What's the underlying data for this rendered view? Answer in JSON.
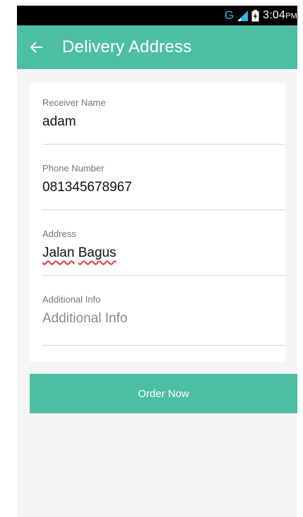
{
  "status_bar": {
    "network_type": "G",
    "time": "3:04",
    "ampm": "PM",
    "icons": [
      "signal-icon",
      "battery-icon"
    ],
    "network_color": "#33b5e5"
  },
  "app_bar": {
    "title": "Delivery Address",
    "back_icon": "arrow-left-icon",
    "background": "#4cbfa2"
  },
  "form": {
    "receiver_name": {
      "label": "Receiver Name",
      "value": "adam"
    },
    "phone_number": {
      "label": "Phone Number",
      "value": "081345678967"
    },
    "address": {
      "label": "Address",
      "value_word_1": "Jalan",
      "value_word_2": "Bagus"
    },
    "additional_info": {
      "label": "Additional Info",
      "placeholder": "Additional Info",
      "value": ""
    }
  },
  "order_button": {
    "label": "Order Now",
    "background": "#4cbfa2"
  }
}
